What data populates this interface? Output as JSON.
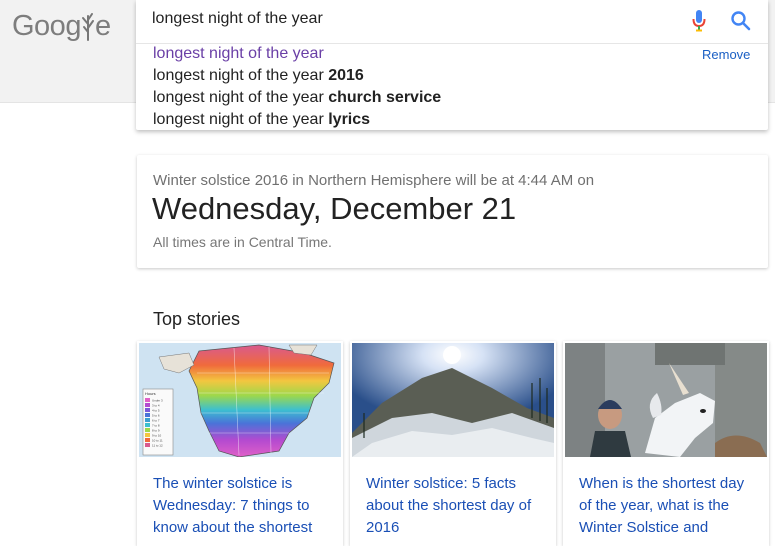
{
  "logo": {
    "text_part1": "Goog",
    "text_part2": "e"
  },
  "search": {
    "query": "longest night of the year",
    "suggestions": [
      {
        "prefix": "longest night of the year",
        "suffix": "",
        "visited": true
      },
      {
        "prefix": "longest night of the year ",
        "suffix": "2016",
        "visited": false
      },
      {
        "prefix": "longest night of the year ",
        "suffix": "church service",
        "visited": false
      },
      {
        "prefix": "longest night of the year ",
        "suffix": "lyrics",
        "visited": false
      }
    ],
    "remove_label": "Remove"
  },
  "answer": {
    "subtitle": "Winter solstice 2016 in Northern Hemisphere will be at 4:44 AM on",
    "date": "Wednesday, December 21",
    "note": "All times are in Central Time."
  },
  "top_stories": {
    "title": "Top stories",
    "items": [
      {
        "headline": "The winter solstice is Wednesday: 7 things to know about the shortest"
      },
      {
        "headline": "Winter solstice: 5 facts about the shortest day of 2016"
      },
      {
        "headline": "When is the shortest day of the year, what is the Winter Solstice and"
      }
    ]
  },
  "map_legend": {
    "title": "Hours",
    "rows": [
      "Under 3",
      "3 to 4",
      "4 to 5",
      "5 to 6",
      "6 to 7",
      "7 to 8",
      "8 to 9",
      "9 to 10",
      "10 to 11",
      "11 to 12"
    ]
  },
  "colors": {
    "link": "#1a4fb5",
    "visited": "#6a3fa6",
    "search_blue": "#4285f4"
  }
}
